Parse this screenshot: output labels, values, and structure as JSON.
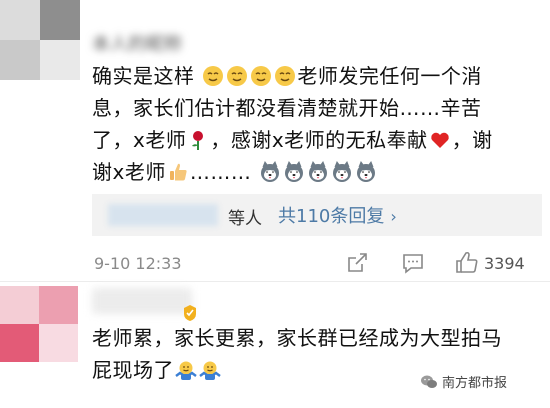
{
  "comments": [
    {
      "username": "本人的昵称",
      "text_segments": [
        "确实是这样",
        "老师发完任何一个消息，家长们估计都没看清楚就开始……辛苦了，x老师",
        "，感谢x老师的无私奉献",
        "，谢谢x老师",
        "………"
      ],
      "inline_icons": [
        "relieved-face-icon",
        "rose-icon",
        "red-heart-icon",
        "thumbs-up-icon",
        "husky-dog-icon"
      ],
      "reply_partial": "等人",
      "reply_count": "共110条回复",
      "reply_chevron": "›",
      "timestamp": "9-10 12:33",
      "like_count": "3394",
      "avatar_colors": [
        "#d9d9d9",
        "#9d9d9d",
        "#c7c7c7",
        "#e8e8e8"
      ]
    },
    {
      "text_segments": [
        "老师累，家长更累，家长群已经成为大型拍马屁现场了"
      ],
      "inline_icons": [
        "shrug-face-icon",
        "gold-badge-icon"
      ],
      "avatar_colors": [
        "#f2c6cf",
        "#ea9aab",
        "#e05c76",
        "#f7d8df"
      ]
    }
  ],
  "watermark": {
    "text": "南方都市报",
    "icon": "wechat-icon"
  }
}
